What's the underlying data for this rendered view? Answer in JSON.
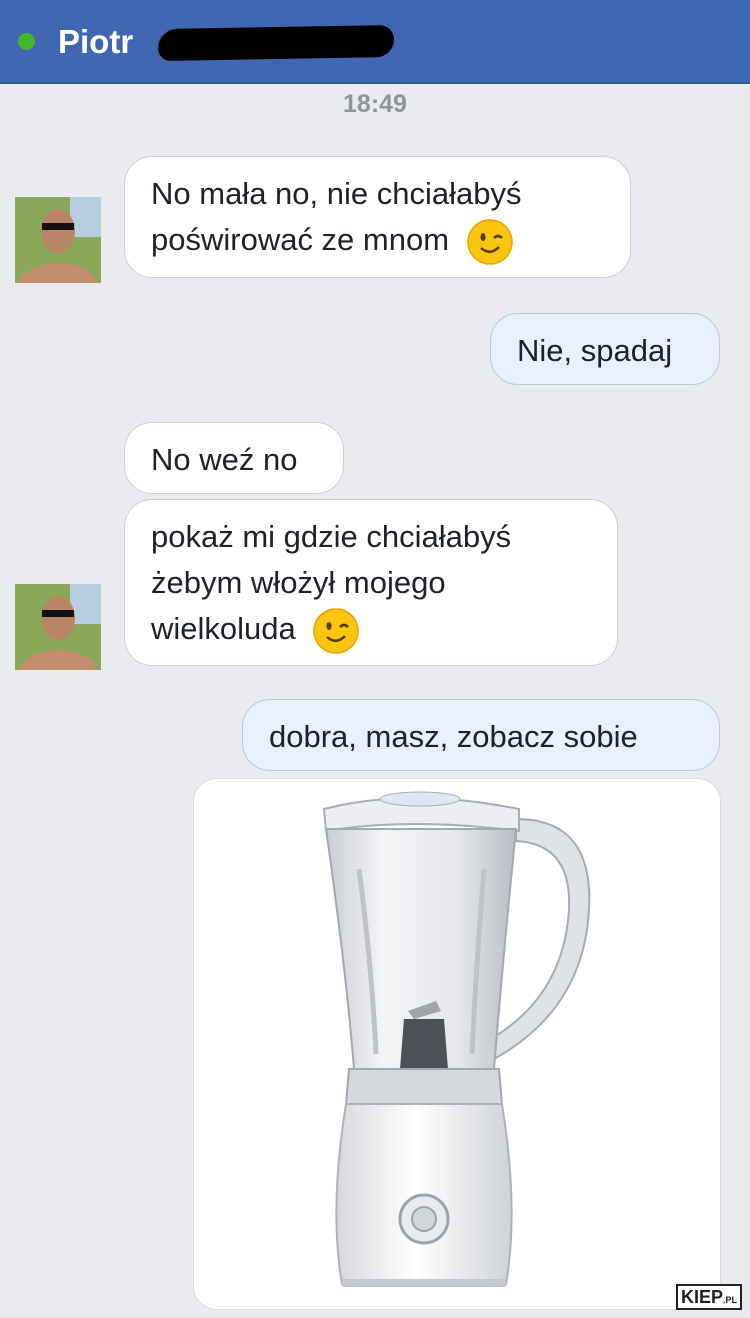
{
  "header": {
    "contact_name": "Piotr",
    "status": "online"
  },
  "timestamp": "18:49",
  "messages": [
    {
      "direction": "incoming",
      "lines": [
        "No mała no, nie chciałabyś",
        "poświrować ze mnom"
      ],
      "emoji": "wink-emoji-icon"
    },
    {
      "direction": "outgoing",
      "text": "Nie, spadaj"
    },
    {
      "direction": "incoming",
      "text": "No weź no"
    },
    {
      "direction": "incoming",
      "lines": [
        "pokaż mi gdzie chciałabyś",
        "żebym włożył mojego",
        "wielkoluda"
      ],
      "emoji": "wink-emoji-icon"
    },
    {
      "direction": "outgoing",
      "text": "dobra, masz, zobacz sobie"
    },
    {
      "direction": "outgoing",
      "attachment": "blender-photo"
    }
  ],
  "watermark": {
    "main": "KIEP",
    "suffix": ".PL"
  },
  "colors": {
    "header": "#4267b2",
    "online_dot": "#42b72a",
    "background": "#e9ebee",
    "incoming_bubble": "#ffffff",
    "outgoing_bubble": "#e7f0fd"
  }
}
